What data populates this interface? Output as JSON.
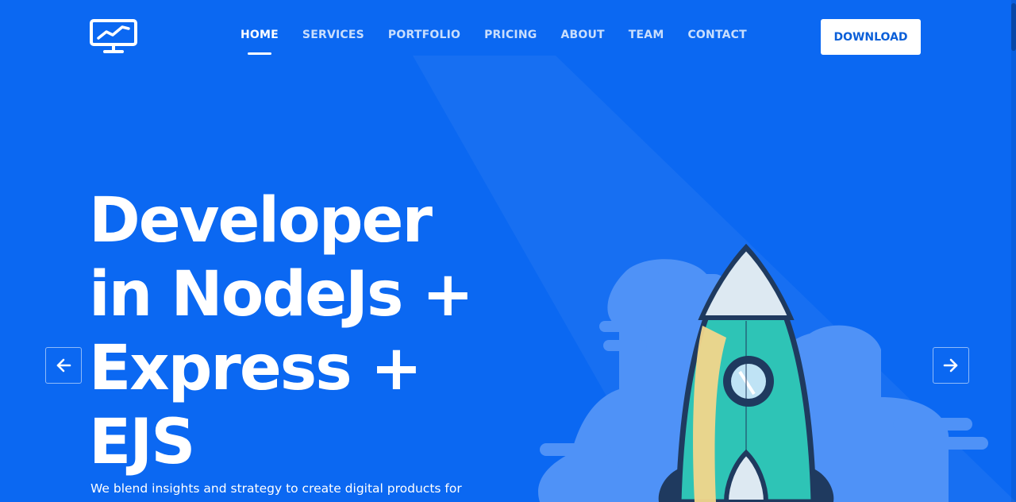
{
  "navbar": {
    "logo_icon": "monitor-chart-icon",
    "links": [
      {
        "label": "HOME",
        "active": true
      },
      {
        "label": "SERVICES",
        "active": false
      },
      {
        "label": "PORTFOLIO",
        "active": false
      },
      {
        "label": "PRICING",
        "active": false
      },
      {
        "label": "ABOUT",
        "active": false
      },
      {
        "label": "TEAM",
        "active": false
      },
      {
        "label": "CONTACT",
        "active": false
      }
    ],
    "download_label": "DOWNLOAD"
  },
  "hero": {
    "headline_lines": [
      "Developer",
      "in NodeJs +",
      "Express +",
      "EJS"
    ],
    "subtext": "We blend insights and strategy to create digital products for",
    "prev_icon": "arrow-left-icon",
    "next_icon": "arrow-right-icon",
    "illustration_icon": "rocket-icon"
  },
  "colors": {
    "background": "#0b68f2",
    "button_text": "#0b5fd8",
    "rocket_body": "#2ec4b6",
    "rocket_outline": "#1f3a5f",
    "cloud": "#4f92f7"
  }
}
